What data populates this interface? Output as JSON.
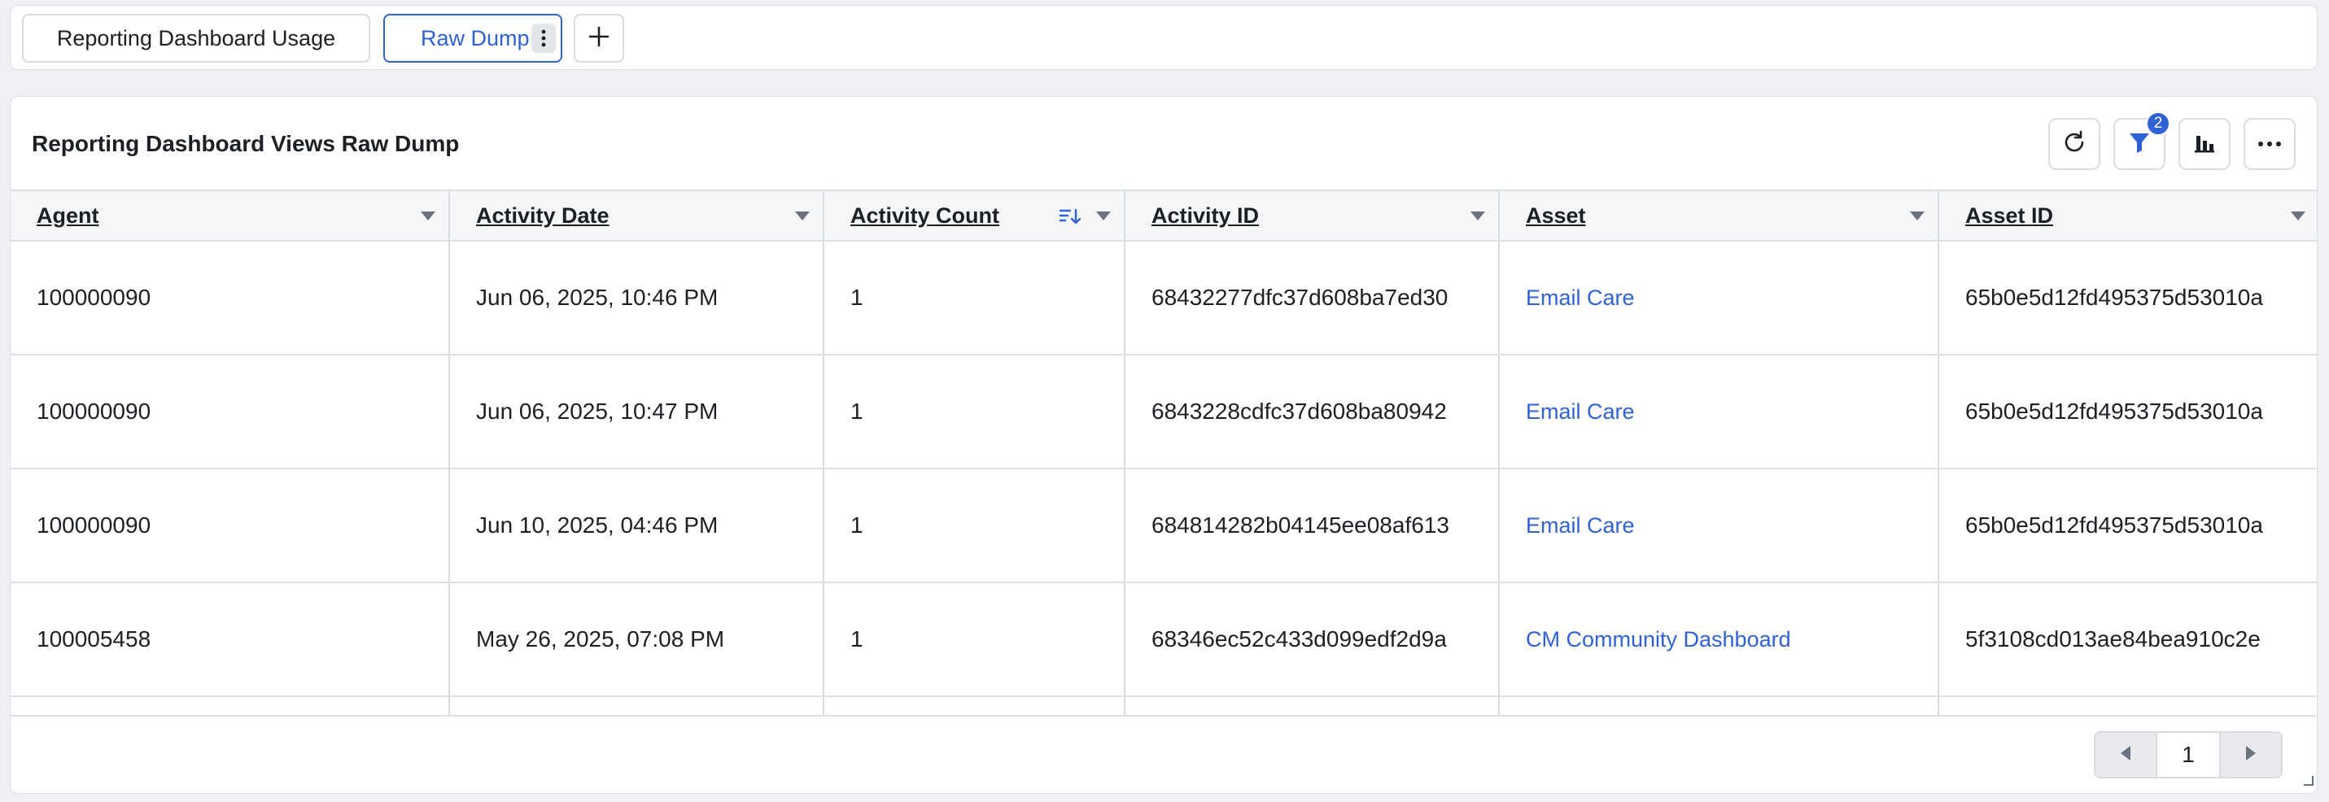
{
  "tabs": {
    "items": [
      {
        "label": "Reporting Dashboard Usage",
        "active": false
      },
      {
        "label": "Raw Dump",
        "active": true
      }
    ]
  },
  "card": {
    "title": "Reporting Dashboard Views Raw Dump",
    "filter_badge_count": "2"
  },
  "table": {
    "columns": [
      "Agent",
      "Activity Date",
      "Activity Count",
      "Activity ID",
      "Asset",
      "Asset ID"
    ],
    "rows": [
      [
        "100000090",
        "Jun 06, 2025, 10:46 PM",
        "1",
        "68432277dfc37d608ba7ed30",
        "Email Care",
        "65b0e5d12fd495375d53010a"
      ],
      [
        "100000090",
        "Jun 06, 2025, 10:47 PM",
        "1",
        "6843228cdfc37d608ba80942",
        "Email Care",
        "65b0e5d12fd495375d53010a"
      ],
      [
        "100000090",
        "Jun 10, 2025, 04:46 PM",
        "1",
        "684814282b04145ee08af613",
        "Email Care",
        "65b0e5d12fd495375d53010a"
      ],
      [
        "100005458",
        "May 26, 2025, 07:08 PM",
        "1",
        "68346ec52c433d099edf2d9a",
        "CM Community Dashboard",
        "5f3108cd013ae84bea910c2e"
      ]
    ]
  },
  "pagination": {
    "current_page": "1"
  },
  "colors": {
    "accent": "#2f62d6",
    "border": "#dcdfe4",
    "header_bg": "#f5f6f8"
  },
  "icons": [
    "kebab-icon",
    "plus-icon",
    "refresh-icon",
    "filter-icon",
    "bar-chart-icon",
    "more-icon",
    "sort-icon",
    "caret-down-icon",
    "chevron-left-icon",
    "chevron-right-icon",
    "resize-icon"
  ]
}
